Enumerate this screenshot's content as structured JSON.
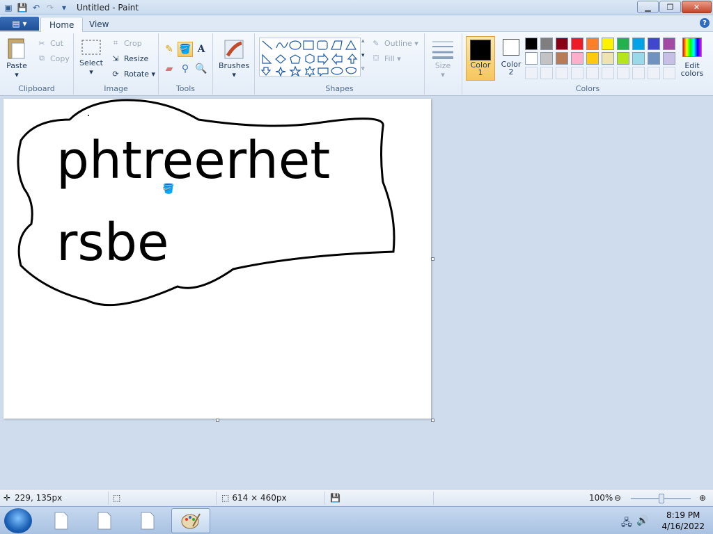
{
  "window": {
    "title": "Untitled - Paint"
  },
  "tabs": {
    "home": "Home",
    "view": "View"
  },
  "clipboard": {
    "paste": "Paste",
    "cut": "Cut",
    "copy": "Copy",
    "group": "Clipboard"
  },
  "image": {
    "select": "Select",
    "crop": "Crop",
    "resize": "Resize",
    "rotate": "Rotate",
    "group": "Image"
  },
  "tools": {
    "group": "Tools"
  },
  "brushes": {
    "label": "Brushes"
  },
  "shapes": {
    "outline": "Outline",
    "fill": "Fill",
    "group": "Shapes"
  },
  "size": {
    "label": "Size"
  },
  "colors": {
    "color1_line1": "Color",
    "color1_line2": "1",
    "color2_line1": "Color",
    "color2_line2": "2",
    "edit_line1": "Edit",
    "edit_line2": "colors",
    "group": "Colors",
    "color1": "#000000",
    "color2": "#ffffff",
    "palette_row1": [
      "#000000",
      "#7f7f7f",
      "#880015",
      "#ed1c24",
      "#ff7f27",
      "#fff200",
      "#22b14c",
      "#00a2e8",
      "#3f48cc",
      "#a349a4"
    ],
    "palette_row2": [
      "#ffffff",
      "#c3c3c3",
      "#b97a57",
      "#ffaec9",
      "#ffc90e",
      "#efe4b0",
      "#b5e61d",
      "#99d9ea",
      "#7092be",
      "#c8bfe7"
    ]
  },
  "canvas": {
    "line1": "phtreerhet",
    "line2": "rsbe"
  },
  "status": {
    "cursor_pos": "229, 135px",
    "image_size": "614 × 460px",
    "zoom": "100%"
  },
  "taskbar": {
    "time": "8:19 PM",
    "date": "4/16/2022"
  }
}
